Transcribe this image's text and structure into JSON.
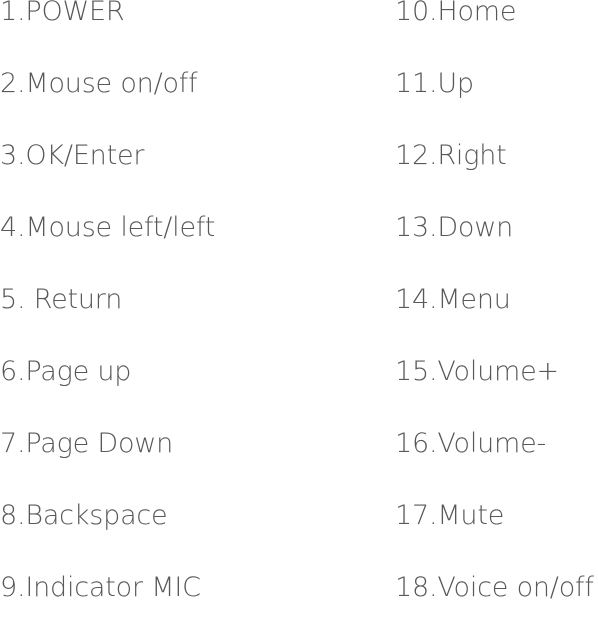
{
  "left_column": [
    "1.POWER",
    "2.Mouse on/off",
    "3.OK/Enter",
    "4.Mouse left/left",
    "5. Return",
    "6.Page up",
    "7.Page Down",
    "8.Backspace",
    "9.Indicator MIC"
  ],
  "right_column": [
    "10.Home",
    "11.Up",
    "12.Right",
    "13.Down",
    "14.Menu",
    "15.Volume+",
    "16.Volume-",
    "17.Mute",
    "18.Voice on/off"
  ]
}
